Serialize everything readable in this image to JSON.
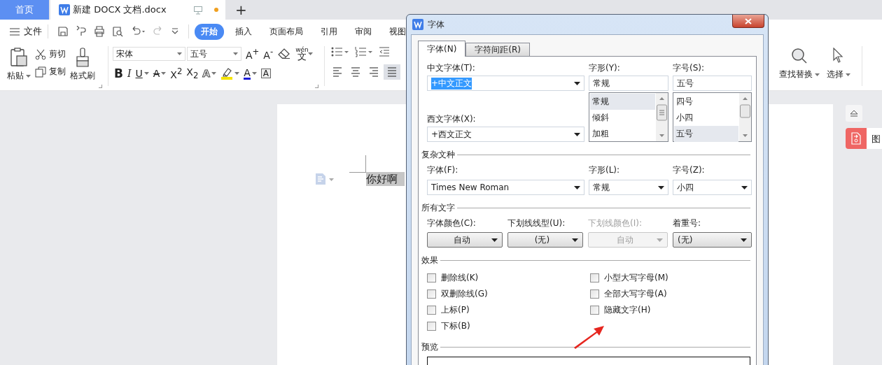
{
  "app_tabs": [
    {
      "kind": "home",
      "label": "首页"
    },
    {
      "kind": "document",
      "label": "新建 DOCX 文档.docx",
      "unsaved": true
    }
  ],
  "new_tab": "+",
  "menu": {
    "file": "文件",
    "tabs": [
      {
        "label": "开始",
        "selected": true
      },
      {
        "label": "插入",
        "selected": false
      },
      {
        "label": "页面布局",
        "selected": false
      },
      {
        "label": "引用",
        "selected": false
      },
      {
        "label": "审阅",
        "selected": false
      },
      {
        "label": "视图",
        "selected": false
      }
    ]
  },
  "ribbon": {
    "clipboard": {
      "paste": "粘贴",
      "cut": "剪切",
      "copy": "复制",
      "format_painter": "格式刷"
    },
    "font": {
      "name": "宋体",
      "size": "五号",
      "grow": "A$^{+}$",
      "shrink": "A$^{-}$",
      "pinyin_top": "wén",
      "pinyin_char": "文",
      "format_buttons": [
        {
          "kind": "bold",
          "glyph": "B",
          "dropdown": false
        },
        {
          "kind": "italic",
          "glyph": "I",
          "dropdown": false
        },
        {
          "kind": "underline",
          "glyph": "U",
          "dropdown": true
        },
        {
          "kind": "strike",
          "glyph": "A",
          "dropdown": true
        },
        {
          "kind": "superscript",
          "glyph": "X$^{2}$",
          "dropdown": false
        },
        {
          "kind": "subscript",
          "glyph": "X$_{2}$",
          "dropdown": false
        },
        {
          "kind": "outline",
          "glyph": "A",
          "dropdown": true
        },
        {
          "kind": "highlight",
          "dropdown": true
        },
        {
          "kind": "color",
          "glyph": "A",
          "dropdown": true
        },
        {
          "kind": "shade",
          "glyph": "A",
          "dropdown": false
        }
      ]
    },
    "paragraph": {
      "align": [
        {
          "kind": "left",
          "selected": false
        },
        {
          "kind": "center",
          "selected": false
        },
        {
          "kind": "right",
          "selected": false
        },
        {
          "kind": "justify",
          "selected": true
        }
      ]
    },
    "editing": {
      "find": "查找替换",
      "select": "选择"
    }
  },
  "side_panel": {
    "tab": "图"
  },
  "document": {
    "text": "你好啊",
    "selected": true
  },
  "dialog": {
    "title": "字体",
    "tabs": [
      {
        "label": "字体(N)",
        "selected": true
      },
      {
        "label": "字符间距(R)",
        "selected": false
      }
    ],
    "chinese_font": {
      "label": "中文字体(T):",
      "value": "+中文正文",
      "highlighted": true
    },
    "western_font": {
      "label": "西文字体(X):",
      "value": "+西文正文",
      "highlighted": false
    },
    "style": {
      "label": "字形(Y):",
      "value": "常规",
      "options": [
        {
          "label": "常规",
          "selected": true
        },
        {
          "label": "倾斜",
          "selected": false
        },
        {
          "label": "加粗",
          "selected": false
        }
      ]
    },
    "size": {
      "label": "字号(S):",
      "value": "五号",
      "options": [
        {
          "label": "四号",
          "selected": false
        },
        {
          "label": "小四",
          "selected": false
        },
        {
          "label": "五号",
          "selected": true
        }
      ]
    },
    "complex_script": {
      "heading": "复杂文种",
      "font": {
        "label": "字体(F):",
        "value": "Times New Roman"
      },
      "style": {
        "label": "字形(L):",
        "value": "常规"
      },
      "size": {
        "label": "字号(Z):",
        "value": "小四"
      }
    },
    "all_text": {
      "heading": "所有文字",
      "controls": [
        {
          "label": "字体颜色(C):",
          "value": "自动",
          "kind": "button",
          "disabled": false
        },
        {
          "label": "下划线线型(U):",
          "value": "(无)",
          "kind": "button",
          "disabled": false
        },
        {
          "label": "下划线颜色(I):",
          "value": "自动",
          "kind": "button",
          "disabled": true
        },
        {
          "label": "着重号:",
          "value": "(无)",
          "kind": "combo",
          "disabled": false
        }
      ]
    },
    "effects": {
      "heading": "效果",
      "left": [
        {
          "label": "删除线(K)",
          "checked": false
        },
        {
          "label": "双删除线(G)",
          "checked": false
        },
        {
          "label": "上标(P)",
          "checked": false
        },
        {
          "label": "下标(B)",
          "checked": false
        }
      ],
      "right": [
        {
          "label": "小型大写字母(M)",
          "checked": false
        },
        {
          "label": "全部大写字母(A)",
          "checked": false
        },
        {
          "label": "隐藏文字(H)",
          "checked": false
        }
      ]
    },
    "preview": {
      "heading": "预览"
    }
  }
}
